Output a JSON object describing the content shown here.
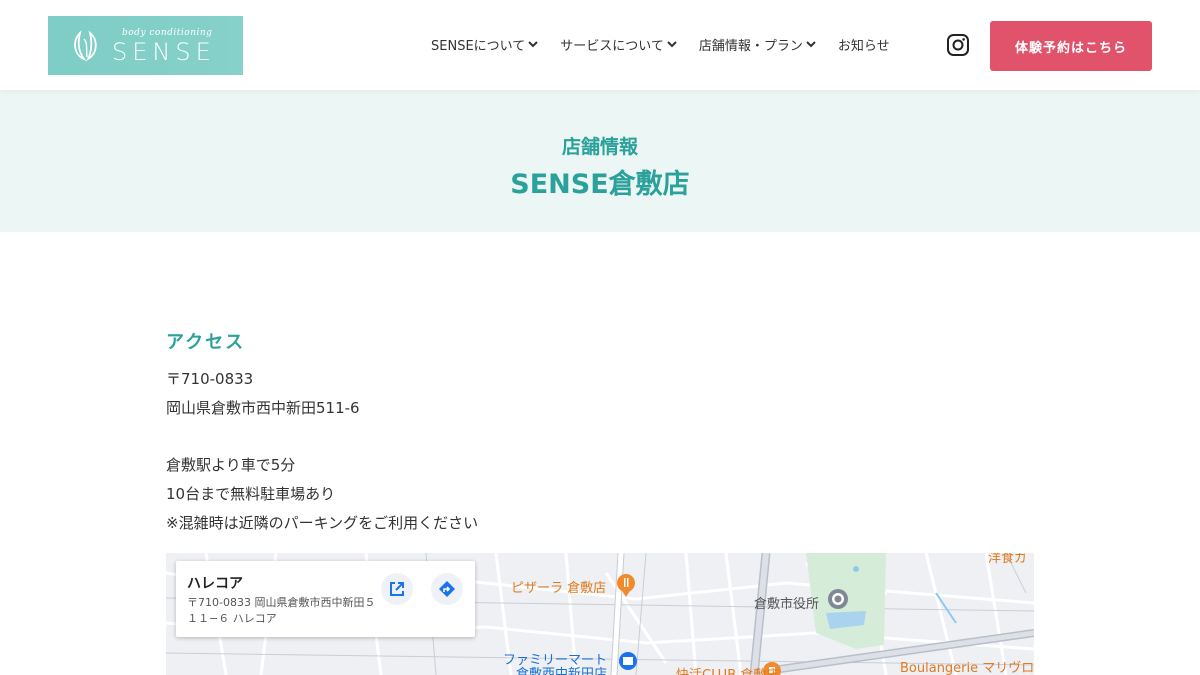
{
  "header": {
    "logo_sub": "body conditioning",
    "logo_main": "SENSE",
    "nav": [
      {
        "label": "SENSEについて",
        "has_dropdown": true
      },
      {
        "label": "サービスについて",
        "has_dropdown": true
      },
      {
        "label": "店舗情報・プラン",
        "has_dropdown": true
      },
      {
        "label": "お知らせ",
        "has_dropdown": false
      }
    ],
    "instagram_icon": "instagram-icon",
    "cta_label": "体験予約はこちら",
    "cta_color": "#e0536b"
  },
  "hero": {
    "subtitle": "店舗情報",
    "title": "SENSE倉敷店",
    "accent_color": "#2aa19a",
    "background": "#ecf6f4"
  },
  "access": {
    "heading": "アクセス",
    "postal": "〒710-0833",
    "address": "岡山県倉敷市西中新田511-6",
    "directions": "倉敷駅より車で5分",
    "parking": "10台まで無料駐車場あり",
    "note": "※混雑時は近隣のパーキングをご利用ください"
  },
  "map": {
    "card_title": "ハレコア",
    "card_address": "〒710-0833 岡山県倉敷市西中新田５１１−６ ハレコア",
    "open_icon": "open-in-new-icon",
    "directions_icon": "directions-icon",
    "labels": {
      "pizza": "ピザーラ 倉敷店",
      "city_hall": "倉敷市役所",
      "familymart_1": "ファミリーマート",
      "familymart_2": "倉敷西中新田店",
      "club": "快活CLUB 倉敷店",
      "boulangerie": "Boulangerie マリヴロ",
      "top_right": "洋食ガ"
    }
  }
}
